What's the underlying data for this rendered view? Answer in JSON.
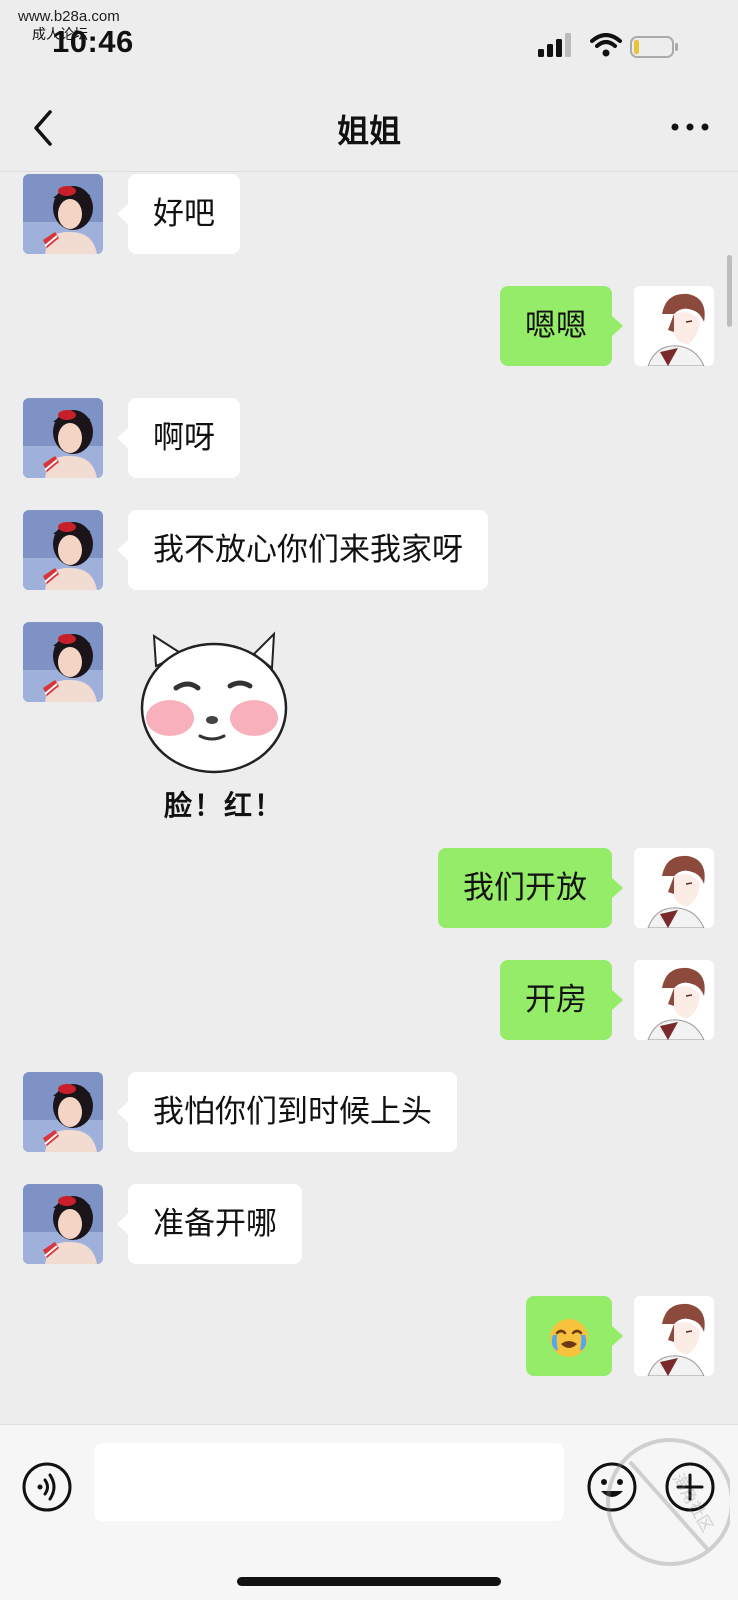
{
  "watermark": {
    "site": "www.b28a.com",
    "label": "成人论坛",
    "corner_text": "海角社区"
  },
  "status_bar": {
    "time": "10:46",
    "icons": [
      "signal-icon",
      "wifi-icon",
      "battery-icon"
    ]
  },
  "header": {
    "title": "姐姐",
    "back_icon": "chevron-left-icon",
    "more_icon": "more-dots-icon"
  },
  "messages": [
    {
      "side": "left",
      "type": "text",
      "text": "好吧"
    },
    {
      "side": "right",
      "type": "text",
      "text": "嗯嗯"
    },
    {
      "side": "left",
      "type": "text",
      "text": "啊呀"
    },
    {
      "side": "left",
      "type": "text",
      "text": "我不放心你们来我家呀"
    },
    {
      "side": "left",
      "type": "sticker",
      "text": "脸！红！"
    },
    {
      "side": "right",
      "type": "text",
      "text": "我们开放"
    },
    {
      "side": "right",
      "type": "text",
      "text": "开房"
    },
    {
      "side": "left",
      "type": "text",
      "text": "我怕你们到时候上头"
    },
    {
      "side": "left",
      "type": "text",
      "text": "准备开哪"
    },
    {
      "side": "right",
      "type": "emoji",
      "text": "😭"
    }
  ],
  "input_bar": {
    "value": "",
    "icons": [
      "voice-icon",
      "emoji-icon",
      "plus-icon"
    ]
  },
  "colors": {
    "background": "#EDEDED",
    "sent_bubble": "#95EC69",
    "received_bubble": "#FFFFFF"
  }
}
